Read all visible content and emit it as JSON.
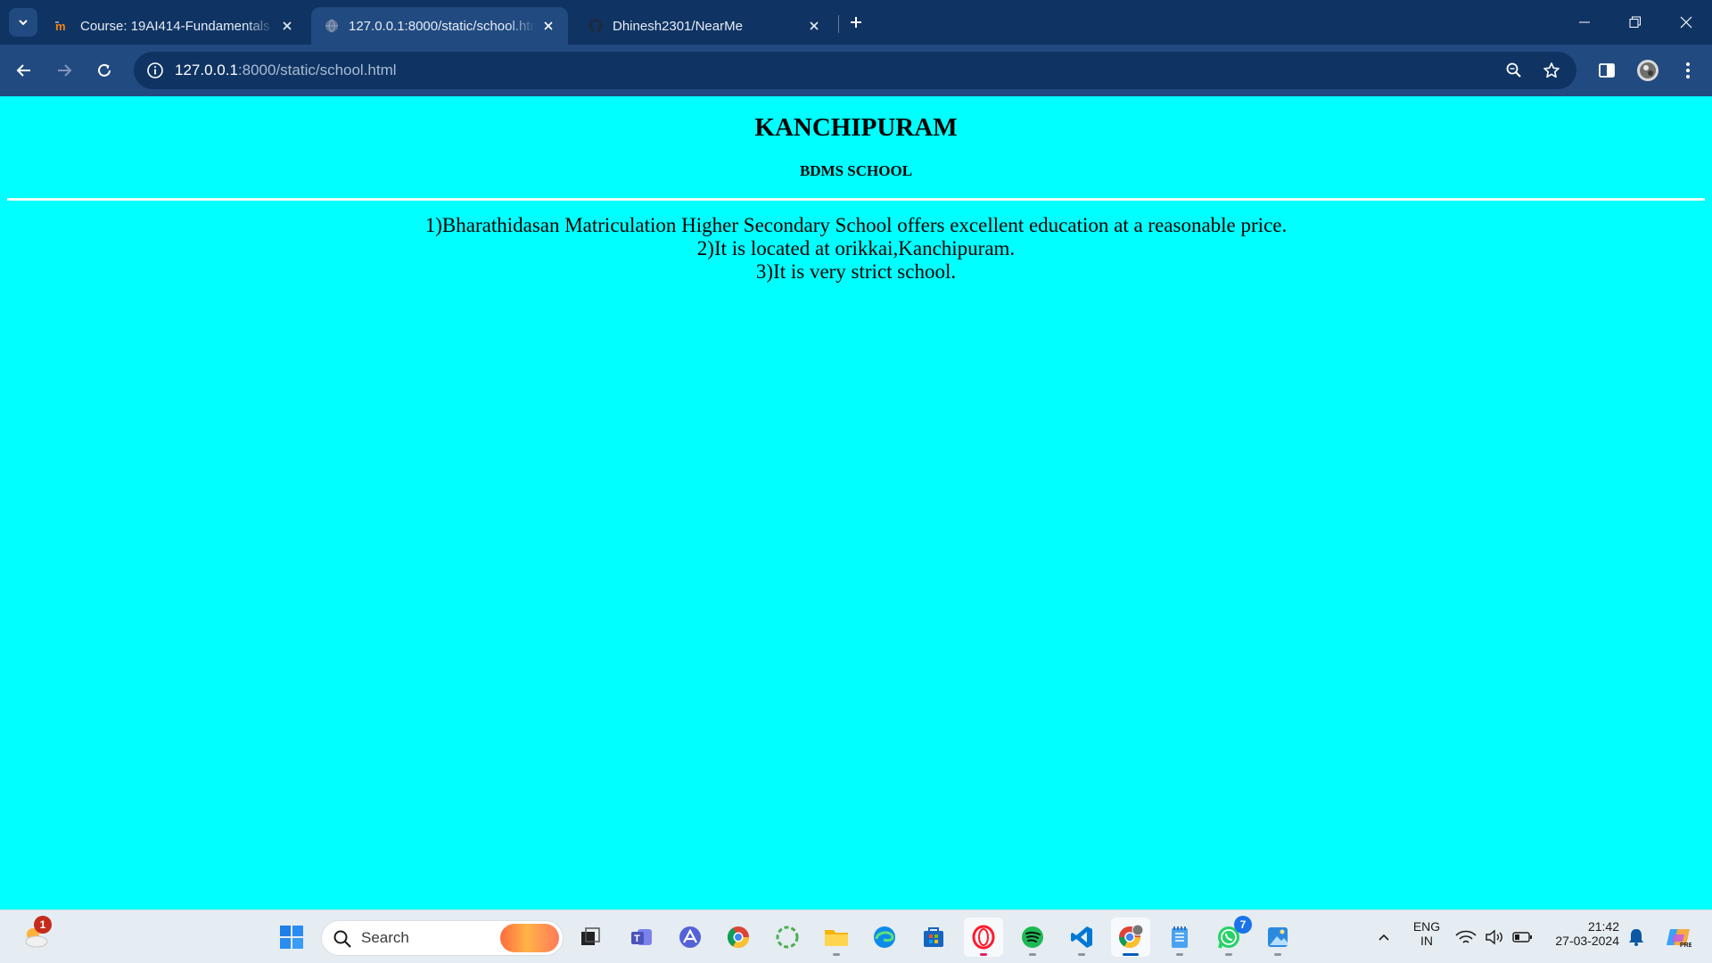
{
  "browser": {
    "tabs": [
      {
        "title": "Course: 19AI414-Fundamentals",
        "favicon": "moodle-icon",
        "state": "inactive"
      },
      {
        "title": "127.0.0.1:8000/static/school.html",
        "favicon": "globe-icon",
        "state": "active"
      },
      {
        "title": "Dhinesh2301/NearMe",
        "favicon": "github-icon",
        "state": "inactive"
      }
    ],
    "address": {
      "host": "127.0.0.1",
      "rest": ":8000/static/school.html"
    }
  },
  "page": {
    "heading": "KANCHIPURAM",
    "subheading": "BDMS SCHOOL",
    "lines": [
      "1)Bharathidasan Matriculation Higher Secondary School offers excellent education at a reasonable price.",
      "2)It is located at orikkai,Kanchipuram.",
      "3)It is very strict school."
    ],
    "background_color": "#00ffff"
  },
  "taskbar": {
    "weather_badge": "1",
    "search_label": "Search",
    "whatsapp_badge": "7",
    "language": "ENG",
    "region": "IN",
    "time": "21:42",
    "date": "27-03-2024",
    "pinned": [
      "windows-start-icon",
      "task-view-icon",
      "teams-icon",
      "arc-icon",
      "chrome-icon",
      "loader-icon",
      "file-explorer-icon",
      "edge-icon",
      "store-icon",
      "opera-icon",
      "spotify-icon",
      "vscode-icon",
      "chrome-profile-icon",
      "notepad-icon",
      "whatsapp-icon",
      "photos-icon"
    ]
  }
}
